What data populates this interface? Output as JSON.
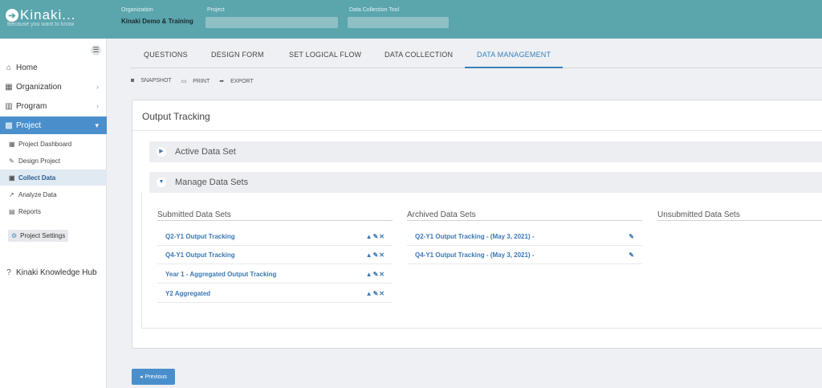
{
  "brand": {
    "name": "Kinaki...",
    "tagline": "Because you want to know",
    "logo_icon": "arrow-right-circle-icon"
  },
  "top": {
    "org_label": "Organization",
    "org_value": "Kinaki Demo & Training",
    "project_label": "Project",
    "tool_label": "Data Collection Tool"
  },
  "nav": {
    "items": [
      {
        "label": "Home",
        "icon": "home-icon"
      },
      {
        "label": "Organization",
        "icon": "building-icon"
      },
      {
        "label": "Program",
        "icon": "bars-icon"
      },
      {
        "label": "Project",
        "icon": "grid-icon"
      }
    ],
    "sub_items": [
      {
        "label": "Project Dashboard",
        "icon": "dashboard-icon"
      },
      {
        "label": "Design Project",
        "icon": "pencil-icon"
      },
      {
        "label": "Collect Data",
        "icon": "collect-icon"
      },
      {
        "label": "Analyze Data",
        "icon": "chart-icon"
      },
      {
        "label": "Reports",
        "icon": "file-icon"
      }
    ],
    "settings": "Project Settings",
    "hub": "Kinaki Knowledge Hub"
  },
  "tabs": [
    "QUESTIONS",
    "DESIGN FORM",
    "SET LOGICAL FLOW",
    "DATA COLLECTION",
    "DATA MANAGEMENT"
  ],
  "active_tab": "DATA MANAGEMENT",
  "actions": {
    "snapshot": "SNAPSHOT",
    "print": "PRINT",
    "export": "EXPORT"
  },
  "panel": {
    "title": "Output Tracking",
    "active_section": "Active Data Set",
    "manage_section": "Manage Data Sets"
  },
  "columns": {
    "submitted": "Submitted Data Sets",
    "archived": "Archived Data Sets",
    "unsubmitted": "Unsubmitted Data Sets"
  },
  "submitted": [
    "Q2-Y1 Output Tracking",
    "Q4-Y1 Output Tracking",
    "Year 1 - Aggregated Output Tracking",
    "Y2 Aggregated"
  ],
  "archived": [
    "Q2-Y1 Output Tracking - (May 3, 2021) -",
    "Q4-Y1 Output Tracking - (May 3, 2021) -"
  ],
  "footer": {
    "previous": "Previous"
  },
  "colors": {
    "brand": "#5ba5ad",
    "accent": "#4a8fcc",
    "link": "#3a78b4"
  }
}
